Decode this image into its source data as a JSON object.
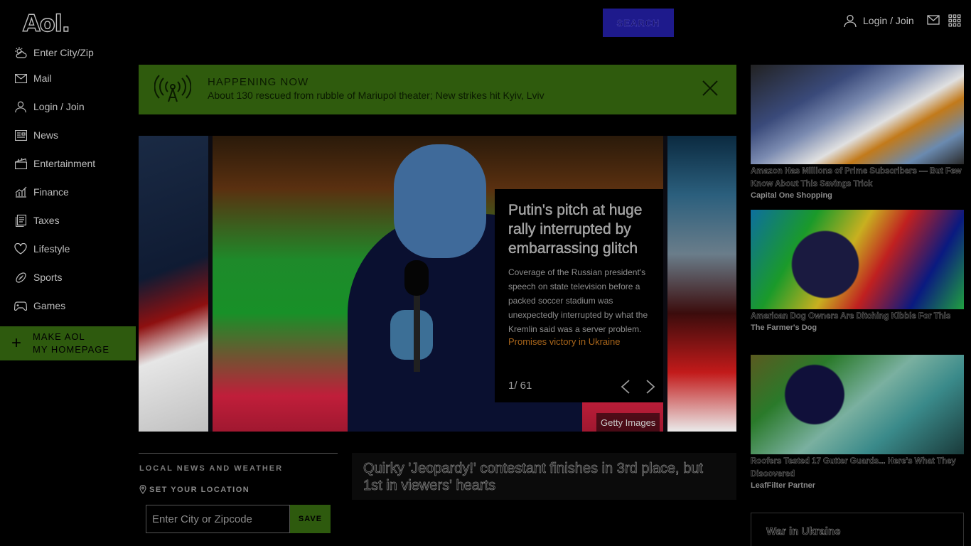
{
  "header": {
    "logo": "Aol.",
    "search_placeholder": "",
    "search_button": "SEARCH",
    "login_label": "Login / Join"
  },
  "sidebar": {
    "items": [
      {
        "label": "Enter City/Zip",
        "icon": "weather-icon"
      },
      {
        "label": "Mail",
        "icon": "mail-icon"
      },
      {
        "label": "Login / Join",
        "icon": "user-icon"
      },
      {
        "label": "News",
        "icon": "news-icon"
      },
      {
        "label": "Entertainment",
        "icon": "clapper-icon"
      },
      {
        "label": "Finance",
        "icon": "chart-icon"
      },
      {
        "label": "Taxes",
        "icon": "document-icon"
      },
      {
        "label": "Lifestyle",
        "icon": "heart-icon"
      },
      {
        "label": "Sports",
        "icon": "football-icon"
      },
      {
        "label": "Games",
        "icon": "gamepad-icon"
      }
    ],
    "make_homepage_line1": "MAKE AOL",
    "make_homepage_line2": "MY HOMEPAGE"
  },
  "happening_now": {
    "title": "HAPPENING NOW",
    "text": "About 130 rescued from rubble of Mariupol theater; New strikes hit Kyiv, Lviv"
  },
  "carousel": {
    "title": "Putin's pitch at huge rally interrupted by embarrassing glitch",
    "description": "Coverage of the Russian president's speech on state television before a packed soccer stadium was unexpectedly interrupted by what the Kremlin said was a server problem.",
    "related_link": "Promises victory in Ukraine",
    "counter": "1/ 61",
    "credit": "Getty Images"
  },
  "local": {
    "title": "LOCAL NEWS AND WEATHER",
    "set_location": "SET YOUR LOCATION",
    "zip_placeholder": "Enter City or Zipcode",
    "save_label": "SAVE"
  },
  "second_story": {
    "title": "Quirky 'Jeopardy!' contestant finishes in 3rd place, but 1st in viewers' hearts"
  },
  "ads": [
    {
      "title": "Amazon Has Millions of Prime Subscribers — But Few Know About This Savings Trick",
      "source": "Capital One Shopping"
    },
    {
      "title": "American Dog Owners Are Ditching Kibble For This",
      "source": "The Farmer's Dog"
    },
    {
      "title": "Roofers Tested 17 Gutter Guards... Here's What They Discovered",
      "source": "LeafFilter Partner"
    }
  ],
  "war_box": {
    "title": "War in Ukraine"
  }
}
